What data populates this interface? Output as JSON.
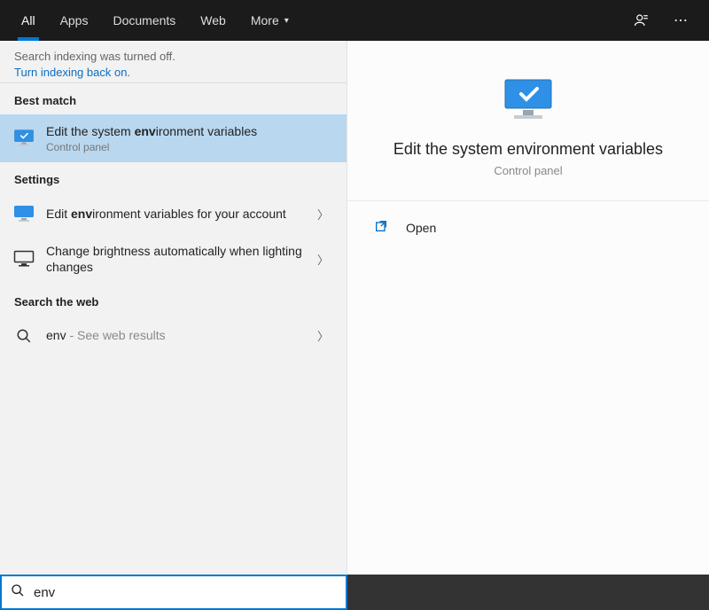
{
  "tabs": {
    "items": [
      "All",
      "Apps",
      "Documents",
      "Web",
      "More"
    ],
    "activeIndex": 0
  },
  "notice": {
    "line1": "Search indexing was turned off.",
    "link": "Turn indexing back on."
  },
  "sections": {
    "bestMatch": "Best match",
    "settings": "Settings",
    "searchWeb": "Search the web"
  },
  "results": {
    "bestMatch": {
      "titlePre": "Edit the system ",
      "titleBold": "env",
      "titlePost": "ironment variables",
      "sub": "Control panel"
    },
    "settings": [
      {
        "titlePre": "Edit ",
        "titleBold": "env",
        "titlePost": "ironment variables for your account"
      },
      {
        "titlePre": "Change brightness automatically when lighting changes",
        "titleBold": "",
        "titlePost": ""
      }
    ],
    "web": {
      "query": "env",
      "suffix": " - See web results"
    }
  },
  "preview": {
    "title": "Edit the system environment variables",
    "sub": "Control panel",
    "actions": [
      {
        "label": "Open"
      }
    ]
  },
  "search": {
    "value": "env"
  }
}
